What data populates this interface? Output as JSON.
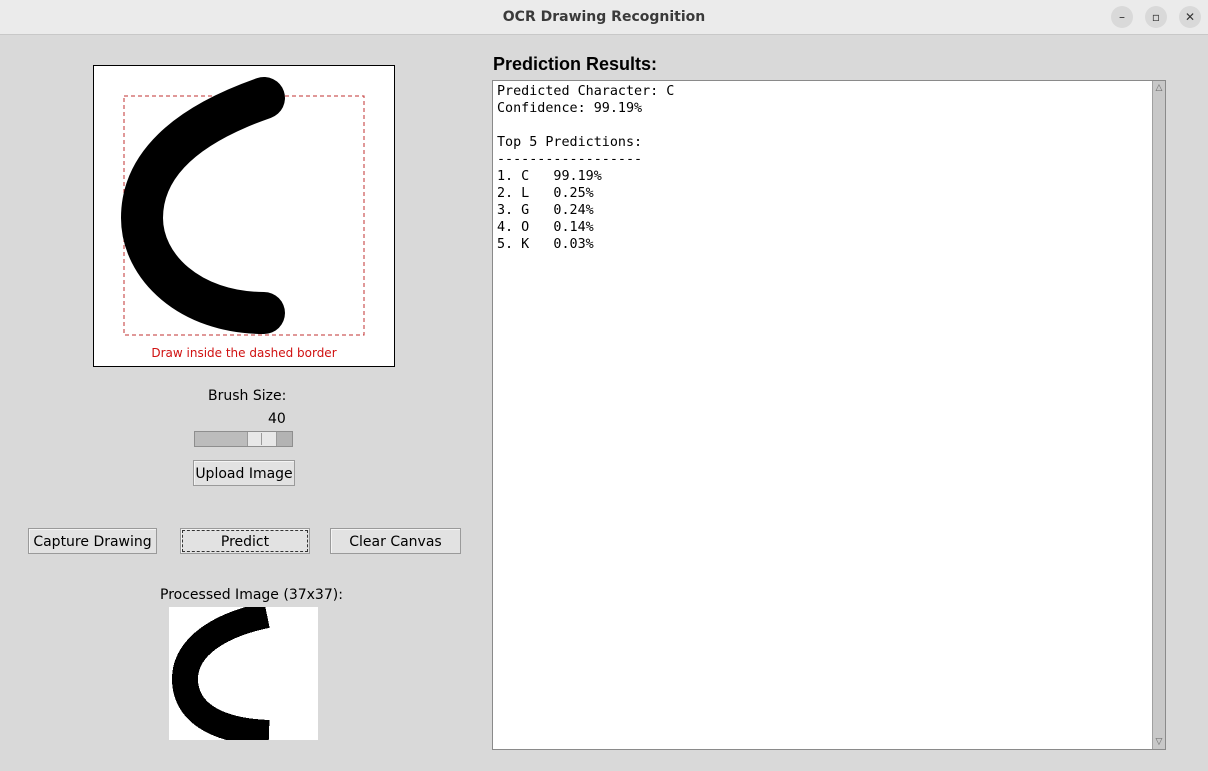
{
  "window": {
    "title": "OCR Drawing Recognition"
  },
  "canvas": {
    "hint": "Draw inside the dashed border"
  },
  "brush": {
    "label": "Brush Size:",
    "value": "40",
    "level_fraction": 0.75
  },
  "buttons": {
    "upload": "Upload Image",
    "capture": "Capture Drawing",
    "predict": "Predict",
    "clear": "Clear Canvas"
  },
  "processed": {
    "label": "Processed Image (37x37):"
  },
  "results": {
    "title": "Prediction Results:",
    "text": "Predicted Character: C\nConfidence: 99.19%\n\nTop 5 Predictions:\n------------------\n1. C   99.19%\n2. L   0.25%\n3. G   0.24%\n4. O   0.14%\n5. K   0.03%"
  },
  "icons": {
    "minimize": "minimize-icon",
    "maximize": "maximize-icon",
    "close": "close-icon"
  }
}
